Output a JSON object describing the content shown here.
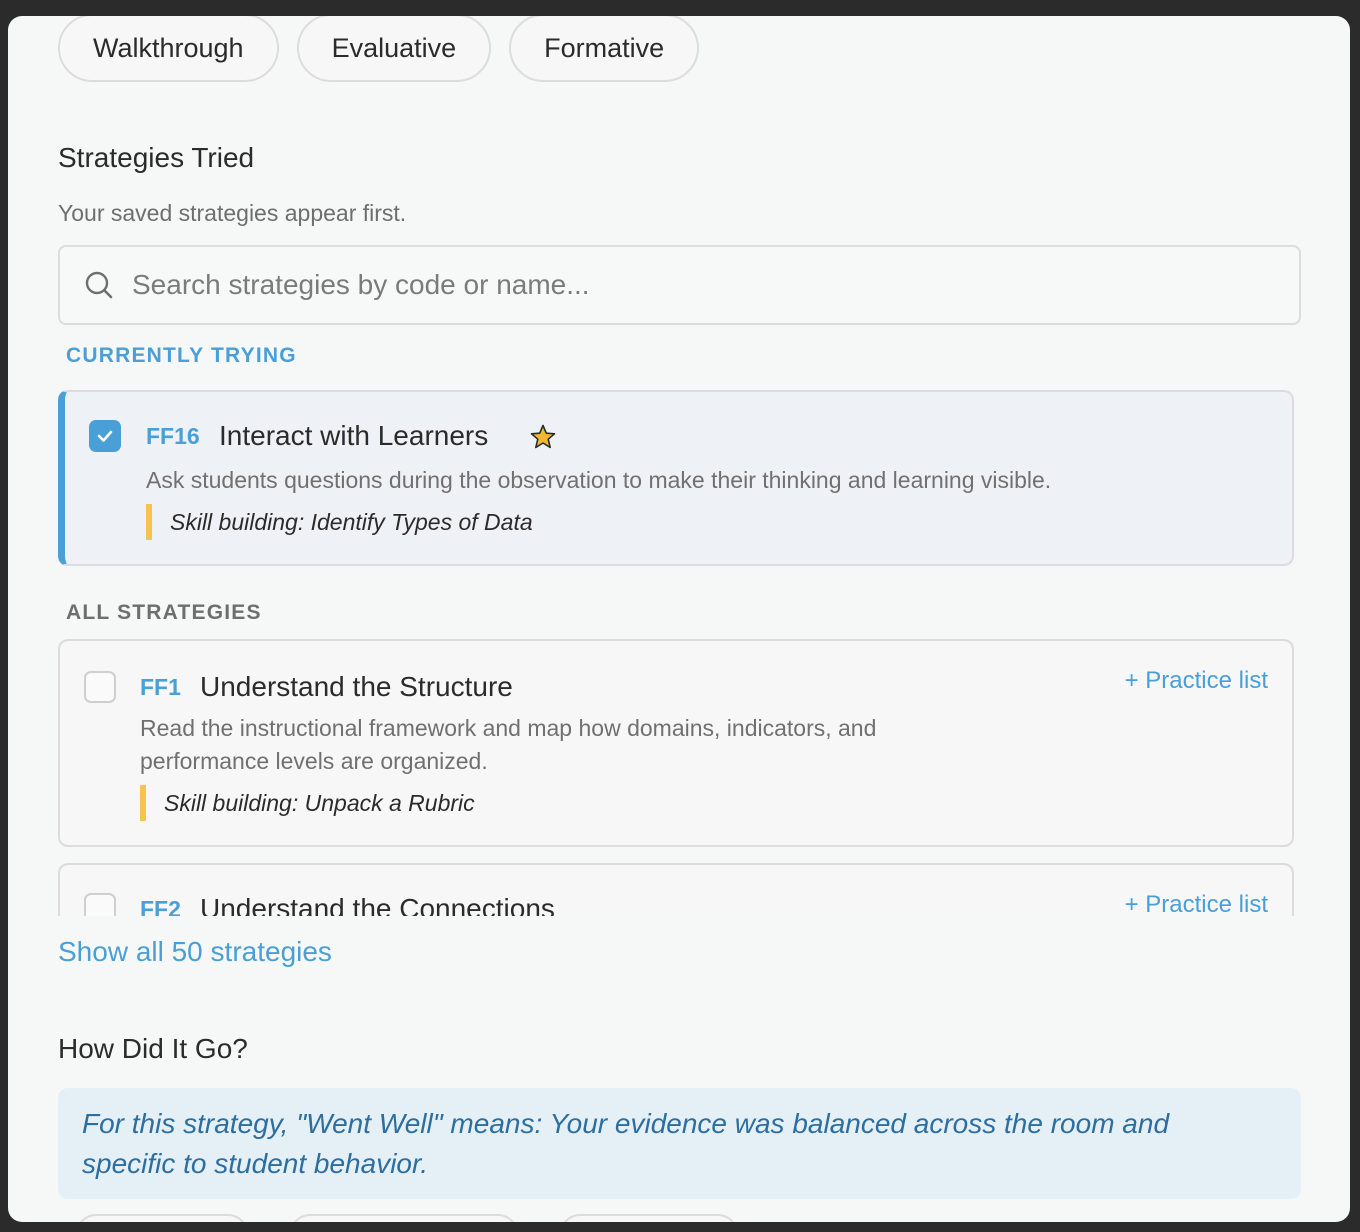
{
  "chips": [
    "Walkthrough",
    "Evaluative",
    "Formative"
  ],
  "strategies_section": {
    "title": "Strategies Tried",
    "subtitle": "Your saved strategies appear first.",
    "search_placeholder": "Search strategies by code or name..."
  },
  "currently_trying": {
    "label": "CURRENTLY TRYING",
    "label_color": "#4a9fd6",
    "item": {
      "code": "FF16",
      "title": "Interact with Learners",
      "starred": true,
      "checked": true,
      "description": "Ask students questions during the observation to make their thinking and learning visible.",
      "skill": "Skill building: Identify Types of Data"
    }
  },
  "all_strategies": {
    "label": "ALL STRATEGIES",
    "label_color": "#6e6e6e",
    "items": [
      {
        "code": "FF1",
        "title": "Understand the Structure",
        "description_line1": "Read the instructional framework and map how domains, indicators, and",
        "description_line2": "performance levels are organized.",
        "skill": "Skill building: Unpack a Rubric",
        "action": "+ Practice list",
        "checked": false
      },
      {
        "code": "FF2",
        "title": "Understand the Connections",
        "action": "+ Practice list",
        "checked": false
      }
    ]
  },
  "show_all": "Show all 50 strategies",
  "how_did_it_go": {
    "title": "How Did It Go?",
    "info_line1": "For this strategy, \"Went Well\" means: Your evidence was balanced across the room and",
    "info_line2": "specific to student behavior."
  },
  "colors": {
    "accent": "#4a9fd6",
    "skill_bar": "#f5c44e",
    "star": "#f2b82f"
  }
}
